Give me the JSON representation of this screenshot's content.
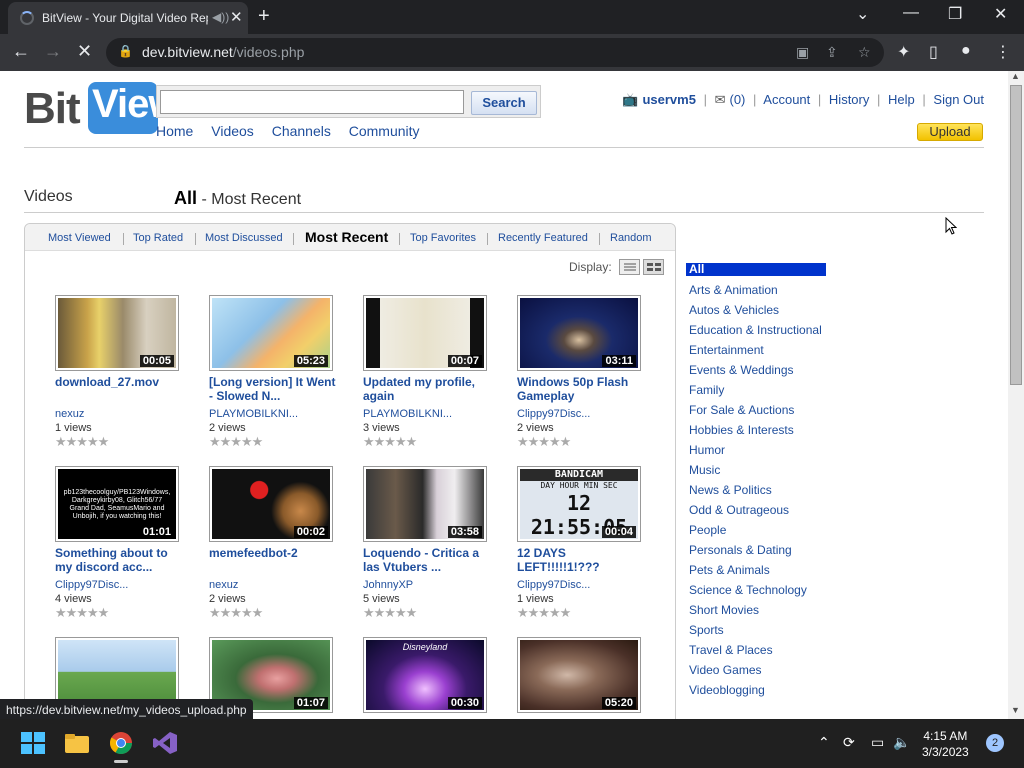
{
  "browser": {
    "tab_title": "BitView - Your Digital Video Repository",
    "url_host": "dev.bitview.net",
    "url_path": "/videos.php"
  },
  "header": {
    "logo_bit": "Bit",
    "logo_view": "View",
    "search_button": "Search",
    "search_value": "",
    "nav": [
      "Home",
      "Videos",
      "Channels",
      "Community"
    ],
    "username": "uservm5",
    "inbox_count": "(0)",
    "account": "Account",
    "history": "History",
    "help": "Help",
    "signout": "Sign Out",
    "upload": "Upload"
  },
  "page": {
    "section": "Videos",
    "filter_bold": "All",
    "filter_rest": " - Most Recent",
    "display_label": "Display:"
  },
  "sort_tabs": [
    "Most Viewed",
    "Top Rated",
    "Most Discussed",
    "Most Recent",
    "Top Favorites",
    "Recently Featured",
    "Random"
  ],
  "videos": [
    {
      "title": "download_27.mov",
      "author": "nexuz",
      "views": "1 views",
      "duration": "00:05",
      "bg": "#8a7a5a"
    },
    {
      "title": "[Long version] It Went - Slowed N...",
      "author": "PLAYMOBILKNI...",
      "views": "2 views",
      "duration": "05:23",
      "bg": "#9cc8e8"
    },
    {
      "title": "Updated my profile, again",
      "author": "PLAYMOBILKNI...",
      "views": "3 views",
      "duration": "00:07",
      "bg": "#e9e6dc"
    },
    {
      "title": "Windows 50p Flash Gameplay",
      "author": "Clippy97Disc...",
      "views": "2 views",
      "duration": "03:11",
      "bg": "#1c2e6a"
    },
    {
      "title": "Something about to my discord acc...",
      "author": "Clippy97Disc...",
      "views": "4 views",
      "duration": "01:01",
      "bg": "#000000"
    },
    {
      "title": "memefeedbot-2",
      "author": "nexuz",
      "views": "2 views",
      "duration": "00:02",
      "bg": "#111111"
    },
    {
      "title": "Loquendo - Critica a las Vtubers ...",
      "author": "JohnnyXP",
      "views": "5 views",
      "duration": "03:58",
      "bg": "#2a2a2a"
    },
    {
      "title": "12 DAYS LEFT!!!!!1!???",
      "author": "Clippy97Disc...",
      "views": "1 views",
      "duration": "00:04",
      "bg": "#dfe6ee"
    },
    {
      "title": "",
      "author": "",
      "views": "",
      "duration": "",
      "bg": "#7fb0e0"
    },
    {
      "title": "",
      "author": "",
      "views": "",
      "duration": "01:07",
      "bg": "#4e8a4a"
    },
    {
      "title": "",
      "author": "",
      "views": "",
      "duration": "00:30",
      "bg": "#2a1a5a"
    },
    {
      "title": "",
      "author": "",
      "views": "",
      "duration": "05:20",
      "bg": "#6a5040"
    }
  ],
  "thumb_text": {
    "v5": "pb123thecoolguy/PB123Windows, Darkgreykirby08, Glitch56/77 Grand Dad, SeamusMario and Unbojih, if you watching this!",
    "v8_top": "BANDICAM",
    "v8_labels": "DAY HOUR MIN SEC",
    "v8_time": "12 21:55:05",
    "v11": "Disneyland"
  },
  "categories": [
    "All",
    "Arts & Animation",
    "Autos & Vehicles",
    "Education & Instructional",
    "Entertainment",
    "Events & Weddings",
    "Family",
    "For Sale & Auctions",
    "Hobbies & Interests",
    "Humor",
    "Music",
    "News & Politics",
    "Odd & Outrageous",
    "People",
    "Personals & Dating",
    "Pets & Animals",
    "Science & Technology",
    "Short Movies",
    "Sports",
    "Travel & Places",
    "Video Games",
    "Videoblogging"
  ],
  "status_url": "https://dev.bitview.net/my_videos_upload.php",
  "taskbar": {
    "time": "4:15 AM",
    "date": "3/3/2023",
    "notifications": "2"
  },
  "colors": {
    "link": "#1f4e9c",
    "category_active_bg": "#0033cc",
    "upload_button": "#f2c200"
  }
}
